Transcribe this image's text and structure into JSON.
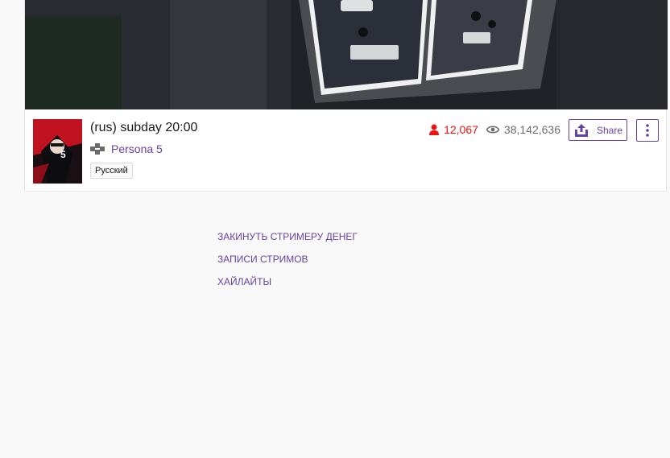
{
  "stream": {
    "title": "(rus) subday 20:00",
    "game": "Persona 5",
    "tag": "Русский",
    "viewers": "12,067",
    "views": "38,142,636"
  },
  "actions": {
    "share_label": "Share"
  },
  "panels": {
    "links": [
      "ЗАКИНУТЬ СТРИМЕРУ ДЕНЕГ",
      "ЗАПИСИ СТРИМОВ",
      "ХАЙЛАЙТЫ"
    ]
  },
  "icons": {
    "viewer": "person-icon",
    "views": "eye-icon",
    "game": "gamepad-icon",
    "share": "share-icon",
    "more": "vertical-ellipsis-icon"
  },
  "colors": {
    "accent": "#6441a4",
    "live": "#ec1313",
    "muted": "#6b6b6b",
    "text": "#19171c"
  }
}
